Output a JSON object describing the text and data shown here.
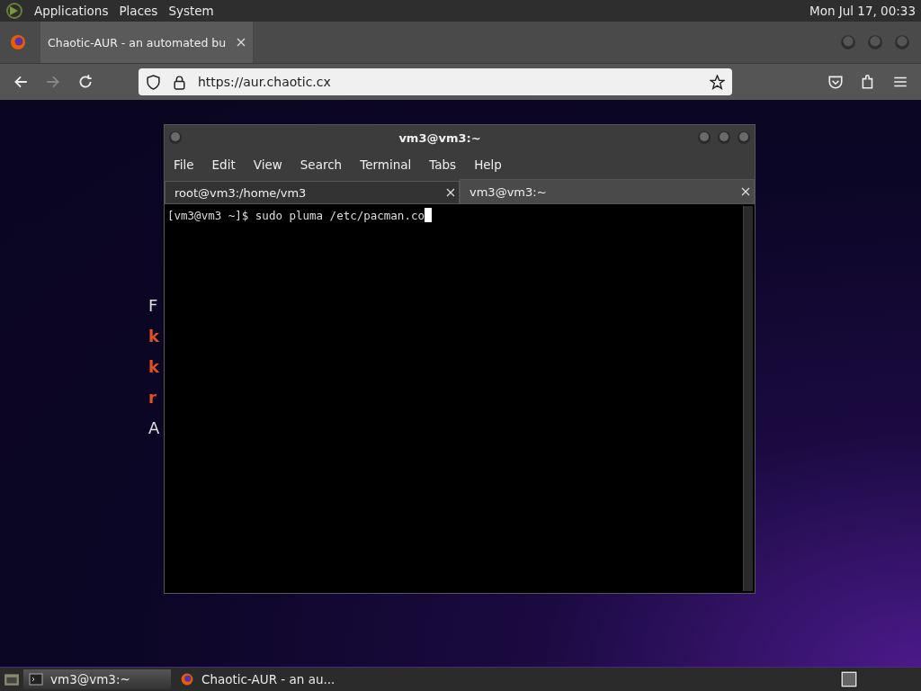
{
  "top_panel": {
    "menus": [
      "Applications",
      "Places",
      "System"
    ],
    "clock": "Mon Jul 17, 00:33"
  },
  "browser": {
    "tabs": [
      {
        "title": "Chaotic-AUR - an automated bu",
        "selected": true
      }
    ],
    "url": "https://aur.chaotic.cx",
    "page_fragments": [
      {
        "text": "F",
        "kind": "plain"
      },
      {
        "text": "k",
        "kind": "accent"
      },
      {
        "text": "k",
        "kind": "accent"
      },
      {
        "text": "r",
        "kind": "accent"
      },
      {
        "text": "A",
        "kind": "plain"
      }
    ]
  },
  "terminal": {
    "title": "vm3@vm3:~",
    "menus": [
      "File",
      "Edit",
      "View",
      "Search",
      "Terminal",
      "Tabs",
      "Help"
    ],
    "tabs": [
      {
        "title": "root@vm3:/home/vm3",
        "selected": false
      },
      {
        "title": "vm3@vm3:~",
        "selected": true
      }
    ],
    "lines": [
      "[vm3@vm3 ~]$ sudo pluma /etc/pacman.co"
    ]
  },
  "taskbar": {
    "items": [
      {
        "label": "vm3@vm3:~",
        "kind": "terminal",
        "selected": true
      },
      {
        "label": "Chaotic-AUR - an au...",
        "kind": "browser",
        "selected": false
      }
    ]
  }
}
